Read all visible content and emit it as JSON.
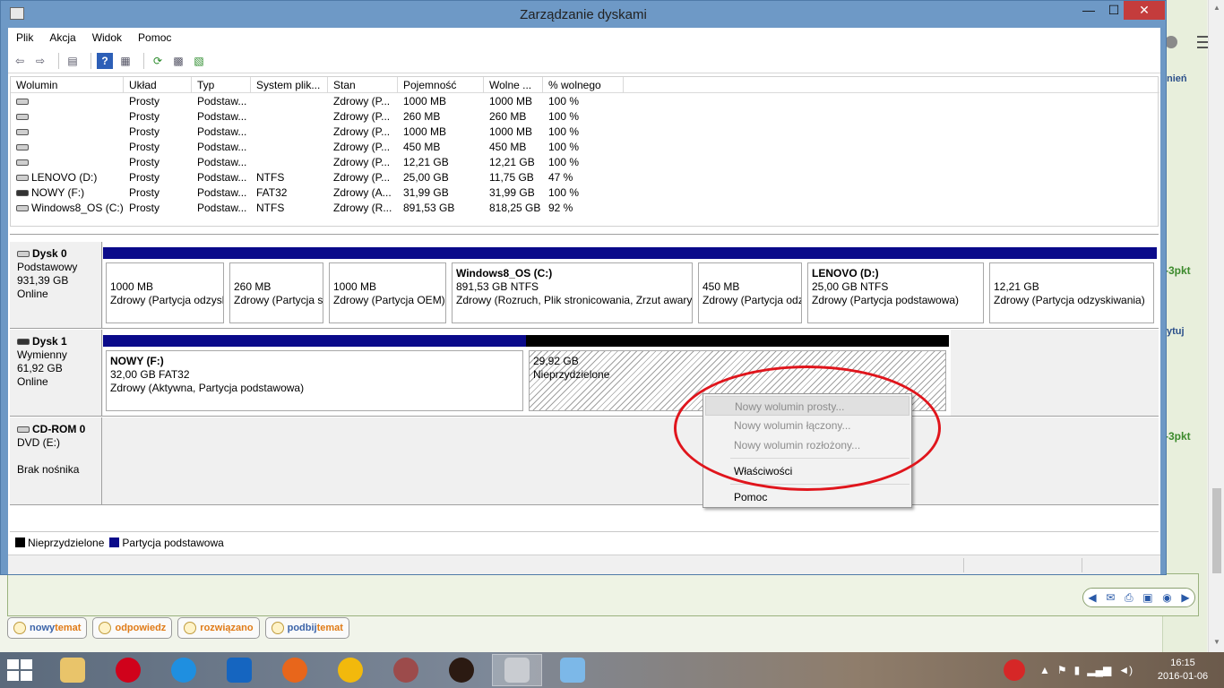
{
  "window": {
    "title": "Zarządzanie dyskami",
    "minimize": "—",
    "maximize": "☐",
    "close": "✕"
  },
  "menu": [
    "Plik",
    "Akcja",
    "Widok",
    "Pomoc"
  ],
  "toolbar_icons": [
    "back-icon",
    "forward-icon",
    "console-tree-icon",
    "help-icon",
    "properties-list-icon",
    "refresh-icon",
    "properties-icon",
    "rescan-icon"
  ],
  "list": {
    "headers": [
      "Wolumin",
      "Układ",
      "Typ",
      "System plik...",
      "Stan",
      "Pojemność",
      "Wolne ...",
      "% wolnego"
    ],
    "rows": [
      [
        "",
        "Prosty",
        "Podstaw...",
        "",
        "Zdrowy (P...",
        "1000 MB",
        "1000 MB",
        "100 %"
      ],
      [
        "",
        "Prosty",
        "Podstaw...",
        "",
        "Zdrowy (P...",
        "260 MB",
        "260 MB",
        "100 %"
      ],
      [
        "",
        "Prosty",
        "Podstaw...",
        "",
        "Zdrowy (P...",
        "1000 MB",
        "1000 MB",
        "100 %"
      ],
      [
        "",
        "Prosty",
        "Podstaw...",
        "",
        "Zdrowy (P...",
        "450 MB",
        "450 MB",
        "100 %"
      ],
      [
        "",
        "Prosty",
        "Podstaw...",
        "",
        "Zdrowy (P...",
        "12,21 GB",
        "12,21 GB",
        "100 %"
      ],
      [
        "LENOVO (D:)",
        "Prosty",
        "Podstaw...",
        "NTFS",
        "Zdrowy (P...",
        "25,00 GB",
        "11,75 GB",
        "47 %"
      ],
      [
        "NOWY (F:)",
        "Prosty",
        "Podstaw...",
        "FAT32",
        "Zdrowy (A...",
        "31,99 GB",
        "31,99 GB",
        "100 %"
      ],
      [
        "Windows8_OS (C:)",
        "Prosty",
        "Podstaw...",
        "NTFS",
        "Zdrowy (R...",
        "891,53 GB",
        "818,25 GB",
        "92 %"
      ]
    ]
  },
  "disks": [
    {
      "name": "Dysk 0",
      "type": "Podstawowy",
      "size": "931,39 GB",
      "status": "Online",
      "partitions": [
        {
          "title": "",
          "line1": "1000 MB",
          "line2": "Zdrowy (Partycja odzyskiwania)"
        },
        {
          "title": "",
          "line1": "260 MB",
          "line2": "Zdrowy (Partycja systemu EFI)"
        },
        {
          "title": "",
          "line1": "1000 MB",
          "line2": "Zdrowy (Partycja OEM)"
        },
        {
          "title": "Windows8_OS  (C:)",
          "line1": "891,53 GB NTFS",
          "line2": "Zdrowy (Rozruch, Plik stronicowania, Zrzut awaryjny)"
        },
        {
          "title": "",
          "line1": "450 MB",
          "line2": "Zdrowy (Partycja odzyskiwania)"
        },
        {
          "title": "LENOVO  (D:)",
          "line1": "25,00 GB NTFS",
          "line2": "Zdrowy (Partycja podstawowa)"
        },
        {
          "title": "",
          "line1": "12,21 GB",
          "line2": "Zdrowy (Partycja odzyskiwania)"
        }
      ]
    },
    {
      "name": "Dysk 1",
      "type": "Wymienny",
      "size": "61,92 GB",
      "status": "Online",
      "partitions": [
        {
          "title": "NOWY  (F:)",
          "line1": "32,00 GB FAT32",
          "line2": "Zdrowy (Aktywna, Partycja podstawowa)"
        },
        {
          "title": "",
          "line1": "29,92 GB",
          "line2": "Nieprzydzielone"
        }
      ]
    },
    {
      "name": "CD-ROM 0",
      "type": "DVD (E:)",
      "size": "",
      "status": "Brak nośnika"
    }
  ],
  "legend": {
    "unallocated": "Nieprzydzielone",
    "primary": "Partycja podstawowa",
    "unallocated_color": "#000000",
    "primary_color": "#0a0a8a"
  },
  "context_menu": {
    "items": [
      "Nowy wolumin prosty...",
      "Nowy wolumin łączony...",
      "Nowy wolumin rozłożony...",
      "Właściwości",
      "Pomoc"
    ]
  },
  "background": {
    "tags": [
      "nień",
      "ytuj"
    ],
    "points": [
      "-3pkt",
      "-3pkt"
    ],
    "buttons": [
      {
        "a": "nowy",
        "b": "temat"
      },
      {
        "a": "odpowiedz",
        "b": ""
      },
      {
        "a": "rozwiązano",
        "b": ""
      },
      {
        "a": "podbij",
        "b": "temat"
      }
    ]
  },
  "taskbar": {
    "apps": [
      "file-explorer-icon",
      "opera-icon",
      "internet-explorer-icon",
      "outlook-icon",
      "firefox-icon",
      "sun-app-icon",
      "media-app-icon",
      "2016-app-icon",
      "disk-management-icon",
      "paint-icon"
    ],
    "time": "16:15",
    "date": "2016-01-06"
  }
}
